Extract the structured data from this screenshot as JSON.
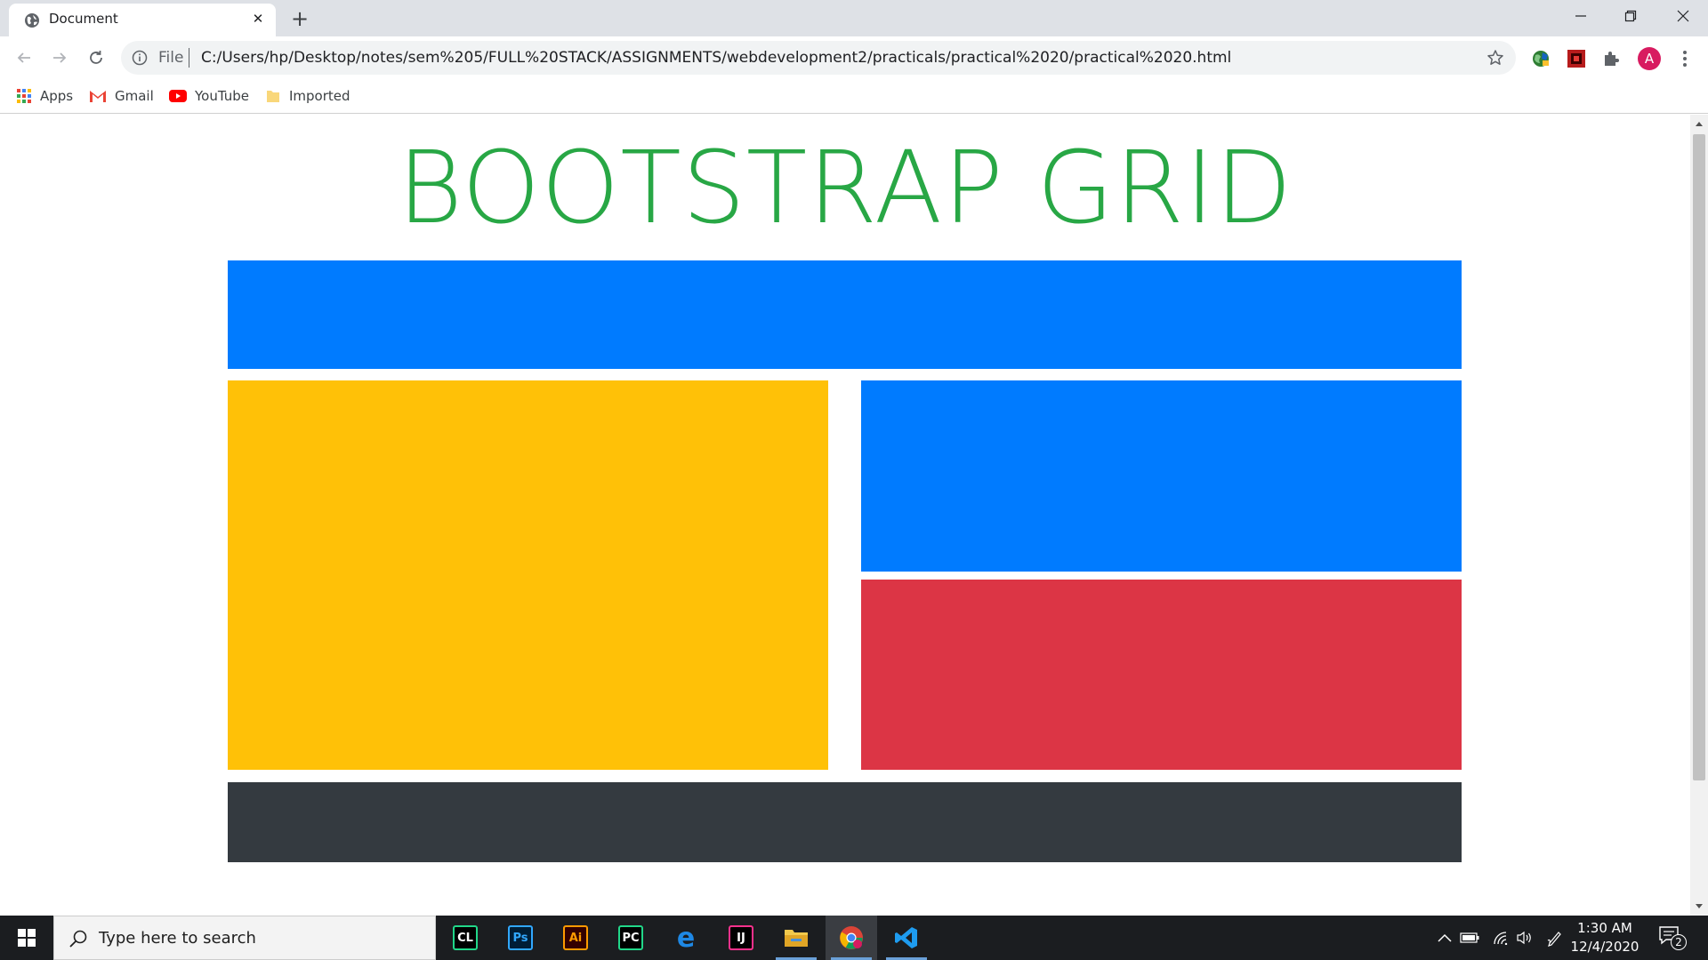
{
  "browser": {
    "tab_title": "Document",
    "tab_close_glyph": "✕",
    "new_tab_glyph": "+",
    "omnibox": {
      "scheme_label": "File",
      "url": "C:/Users/hp/Desktop/notes/sem%205/FULL%20STACK/ASSIGNMENTS/webdevelopment2/practicals/practical%2020/practical%2020.html"
    },
    "profile_initial": "A",
    "bookmarks": [
      {
        "label": "Apps",
        "icon": "apps-grid-icon"
      },
      {
        "label": "Gmail",
        "icon": "gmail-icon"
      },
      {
        "label": "YouTube",
        "icon": "youtube-icon"
      },
      {
        "label": "Imported",
        "icon": "folder-icon"
      }
    ]
  },
  "page": {
    "title": "BOOTSTRAP GRID",
    "colors": {
      "title": "#28a745",
      "primary": "#007bff",
      "warning": "#ffc107",
      "danger": "#dc3545",
      "dark": "#343a40"
    }
  },
  "taskbar": {
    "search_placeholder": "Type here to search",
    "apps": [
      {
        "name": "CLion",
        "glyph": "CL"
      },
      {
        "name": "Photoshop",
        "glyph": "Ps"
      },
      {
        "name": "Illustrator",
        "glyph": "Ai"
      },
      {
        "name": "PyCharm",
        "glyph": "PC"
      },
      {
        "name": "Edge",
        "glyph": "e"
      },
      {
        "name": "IntelliJ IDEA",
        "glyph": "IJ"
      },
      {
        "name": "File Explorer",
        "glyph": ""
      },
      {
        "name": "Chrome",
        "glyph": ""
      },
      {
        "name": "VS Code",
        "glyph": ""
      }
    ],
    "time": "1:30 AM",
    "date": "12/4/2020",
    "notification_count": "2"
  }
}
